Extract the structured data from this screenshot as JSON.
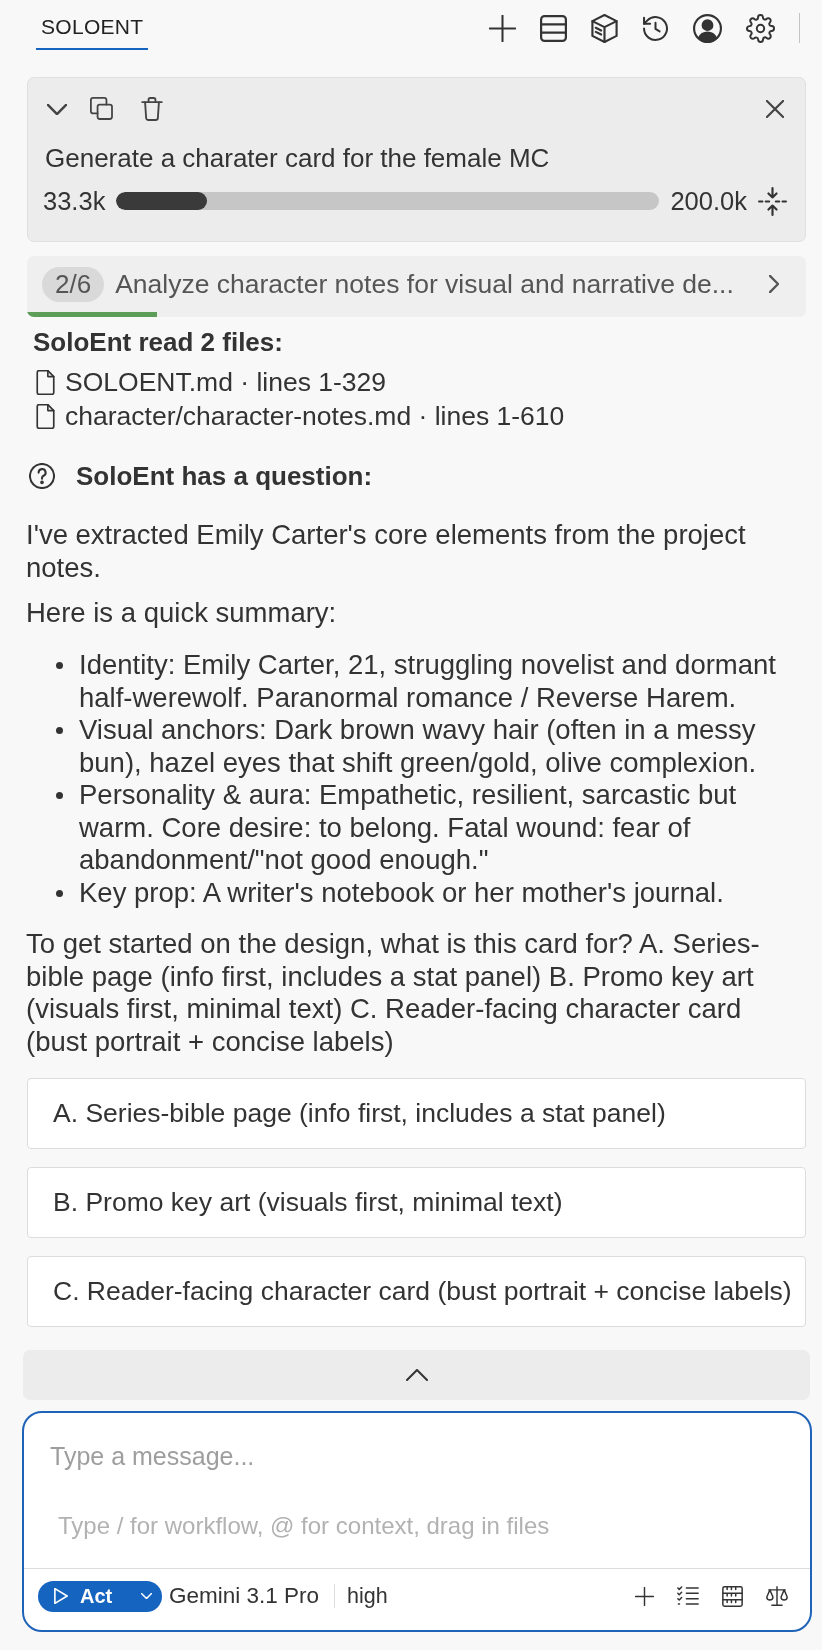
{
  "header": {
    "tabs": [
      {
        "label": "SOLOENT",
        "selected": true
      }
    ]
  },
  "task": {
    "title": "Generate a charater card for the female MC",
    "tokens_used": "33.3k",
    "level": 0.1665,
    "tokens_limit": "200.0k"
  },
  "step": {
    "counter": "2/6",
    "title": "Analyze character notes for visual and narrative de...",
    "level": 0.167
  },
  "files_read": {
    "heading": "SoloEnt read 2 files:",
    "files": [
      {
        "label": "SOLOENT.md · lines 1-329"
      },
      {
        "label": "character/character-notes.md · lines 1-610"
      }
    ]
  },
  "question": {
    "heading": "SoloEnt has a question:",
    "paragraphs": [
      "I've extracted Emily Carter's core elements from the project notes.",
      "Here is a quick summary:"
    ],
    "bullets": [
      "Identity: Emily Carter, 21, struggling novelist and dormant half-werewolf. Paranormal romance / Reverse Harem.",
      "Visual anchors: Dark brown wavy hair (often in a messy bun), hazel eyes that shift green/gold, olive complexion.",
      "Personality & aura: Empathetic, resilient, sarcastic but warm. Core desire: to belong. Fatal wound: fear of abandonment/\"not good enough.\"",
      "Key prop: A writer's notebook or her mother's journal."
    ],
    "prompt": "To get started on the design, what is this card for? A. Series-bible page (info first, includes a stat panel) B. Promo key art (visuals first, minimal text) C. Reader-facing character card (bust portrait + concise labels)",
    "options": [
      {
        "label": "A. Series-bible page (info first, includes a stat panel)",
        "selected": false
      },
      {
        "label": "B. Promo key art (visuals first, minimal text)",
        "selected": false
      },
      {
        "label": "C. Reader-facing character card (bust portrait + concise labels)",
        "selected": false
      }
    ]
  },
  "composer": {
    "placeholder": "Type a message...",
    "hint": "Type / for workflow, @ for context, drag in files",
    "mode": "Act",
    "model": "Gemini 3.1 Pro",
    "effort": "high"
  }
}
